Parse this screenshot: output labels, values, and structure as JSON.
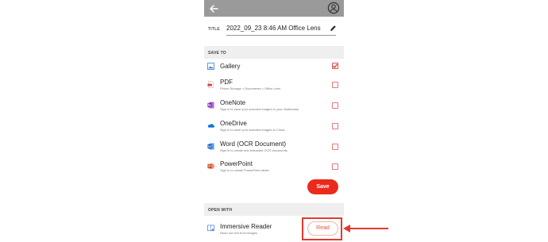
{
  "window": {
    "title": "Save",
    "accent": "#ea2a1b",
    "topbar_color": "#9a9a9a"
  },
  "topbar": {
    "back_icon": "arrow-left-icon",
    "account_icon": "account-circle-icon"
  },
  "title_field": {
    "label": "TITLE",
    "value": "2022_09_23 8:46 AM Office Lens",
    "edit_icon": "pencil-icon"
  },
  "save_to": {
    "header": "SAVE TO",
    "options": [
      {
        "name": "Gallery",
        "subtitle": "",
        "icon": "gallery-icon",
        "checked": true
      },
      {
        "name": "PDF",
        "subtitle": "Phone Storage > Documents > Office Lens",
        "icon": "pdf-icon",
        "checked": false
      },
      {
        "name": "OneNote",
        "subtitle": "Sign in to save your scanned images to your Notebooks",
        "icon": "onenote-icon",
        "checked": false
      },
      {
        "name": "OneDrive",
        "subtitle": "Sign in to save your scanned images to Cloud",
        "icon": "onedrive-icon",
        "checked": false
      },
      {
        "name": "Word (OCR Document)",
        "subtitle": "Sign in to create text-extracted OCR documents",
        "icon": "word-icon",
        "checked": false
      },
      {
        "name": "PowerPoint",
        "subtitle": "Sign in to create PowerPoint slides",
        "icon": "powerpoint-icon",
        "checked": false
      }
    ],
    "save_label": "Save"
  },
  "open_with": {
    "header": "OPEN WITH",
    "app": {
      "name": "Immersive Reader",
      "subtitle": "Read out text from images",
      "icon": "immersive-reader-icon"
    },
    "read_label": "Read"
  },
  "annotation": {
    "color": "#e23a2d",
    "box_icon": "highlight-box",
    "arrow_icon": "arrow-left-pointer"
  }
}
